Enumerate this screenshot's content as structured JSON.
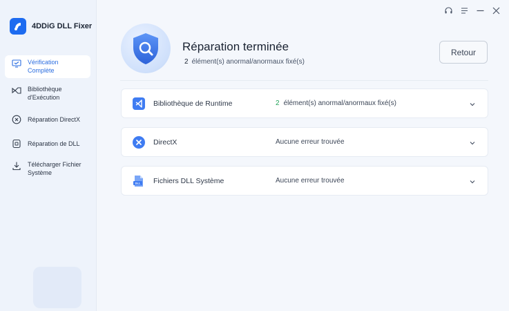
{
  "app": {
    "name": "4DDiG DLL Fixer"
  },
  "sidebar": {
    "items": [
      {
        "label": "Vérification Complète",
        "line1": "Vérification",
        "line2": "Complète",
        "icon": "monitor-check-icon",
        "active": true
      },
      {
        "label": "Bibliothèque d'Exécution",
        "line1": "Bibliothèque",
        "line2": "d'Exécution",
        "icon": "library-icon",
        "active": false
      },
      {
        "label": "Réparation DirectX",
        "icon": "directx-icon",
        "active": false
      },
      {
        "label": "Réparation de DLL",
        "icon": "dll-icon",
        "active": false
      },
      {
        "label": "Télécharger Fichier Système",
        "line1": "Télécharger Fichier",
        "line2": "Système",
        "icon": "download-icon",
        "active": false
      }
    ]
  },
  "titlebar": {
    "icons": [
      "headset-icon",
      "menu-icon",
      "minimize-icon",
      "close-icon"
    ]
  },
  "header": {
    "title": "Réparation terminée",
    "count": "2",
    "count_text": "élément(s) anormal/anormaux fixé(s)",
    "back_label": "Retour"
  },
  "cards": [
    {
      "name": "Bibliothèque de Runtime",
      "count": "2",
      "status": "élément(s) anormal/anormaux fixé(s)",
      "icon": "visual-studio-icon"
    },
    {
      "name": "DirectX",
      "status": "Aucune erreur trouvée",
      "icon": "directx-x-icon"
    },
    {
      "name": "Fichiers DLL Système",
      "status": "Aucune erreur trouvée",
      "icon": "dll-file-icon"
    }
  ],
  "colors": {
    "accent": "#1d6bf0",
    "success": "#22a35a",
    "active_text": "#2a6de0"
  }
}
